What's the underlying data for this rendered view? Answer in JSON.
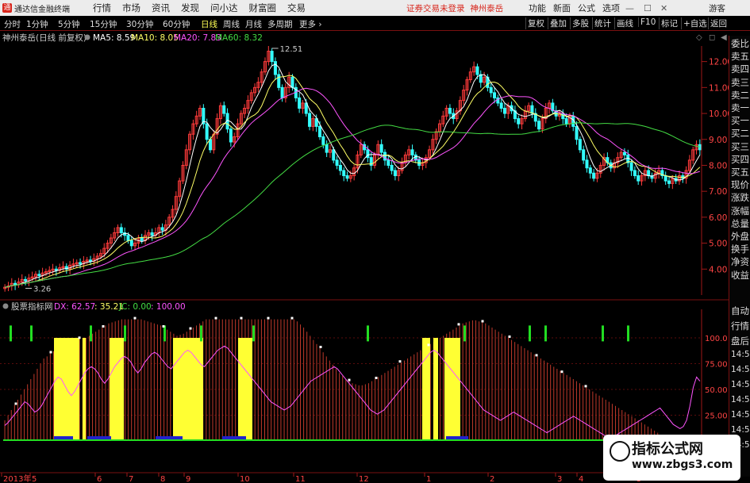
{
  "menubar": {
    "app_title": "通达信金融终端",
    "items": [
      "行情",
      "市场",
      "资讯",
      "发现",
      "问小达",
      "财富圈",
      "交易"
    ],
    "notice": "证券交易未登录",
    "stock": "神州泰岳",
    "right_items": [
      "功能",
      "新面",
      "公式",
      "选项"
    ],
    "guest": "游客"
  },
  "toolbar": {
    "timeframes": [
      "分时",
      "1分钟",
      "5分钟",
      "15分钟",
      "30分钟",
      "60分钟",
      "日线",
      "周线",
      "月线",
      "多周期",
      "更多"
    ],
    "active": "日线",
    "right_buttons": [
      "复权",
      "叠加",
      "多股",
      "统计",
      "画线",
      "F10",
      "标记",
      "+自选",
      "返回"
    ]
  },
  "right_panel": {
    "tabs": [
      "委比",
      "卖五",
      "卖四",
      "卖三",
      "卖二",
      "卖一",
      "买一",
      "买二",
      "买三",
      "买四",
      "买五",
      "现价",
      "涨跌",
      "涨幅",
      "总量",
      "外盘",
      "换手",
      "净资",
      "收益"
    ],
    "tabs2": [
      "自动",
      "行情",
      "盘后",
      "14:50",
      "14:50",
      "14:50",
      "14:50",
      "14:50",
      "14:50",
      "14:50"
    ]
  },
  "colors": {
    "up": "#ff3b3b",
    "down": "#33ffff",
    "ma5": "#ffffff",
    "ma10": "#ffff66",
    "ma20": "#ff55ff",
    "ma60": "#44dd44",
    "bar_red": "#c0392b",
    "bar_yellow": "#ffff33",
    "bar_blue": "#2222cc",
    "green_signal": "#22dd22",
    "dx_line": "#ff55ff"
  },
  "watermark": {
    "line1": "指标公式网",
    "line2": "www.zbgs3.com"
  },
  "chart_data": [
    {
      "type": "candlestick",
      "title": "神州泰岳(日线 前复权)",
      "legend": [
        {
          "name": "MA5",
          "value": "8.59",
          "color": "#ffffff"
        },
        {
          "name": "MA10",
          "value": "8.05",
          "color": "#ffff66"
        },
        {
          "name": "MA20",
          "value": "7.83",
          "color": "#ff55ff"
        },
        {
          "name": "MA60",
          "value": "8.32",
          "color": "#44dd44"
        }
      ],
      "ylim": [
        3.0,
        12.6
      ],
      "yticks": [
        "12.00",
        "11.00",
        "10.00",
        "9.00",
        "8.00",
        "7.00",
        "6.00",
        "5.00",
        "4.00"
      ],
      "ytick_values": [
        12,
        11,
        10,
        9,
        8,
        7,
        6,
        5,
        4
      ],
      "annotations": [
        {
          "text": "12.51",
          "x": 78,
          "y": 12.51
        },
        {
          "text": "3.26",
          "x": 6,
          "y": 3.26
        }
      ],
      "close": [
        3.3,
        3.35,
        3.45,
        3.4,
        3.5,
        3.6,
        3.55,
        3.65,
        3.7,
        3.8,
        3.75,
        3.85,
        3.9,
        3.95,
        4.0,
        3.95,
        4.05,
        4.1,
        4.0,
        4.15,
        4.2,
        4.25,
        4.2,
        4.3,
        4.35,
        4.3,
        4.4,
        4.5,
        4.6,
        4.8,
        5.0,
        5.2,
        5.4,
        5.6,
        5.4,
        5.3,
        5.1,
        4.9,
        5.0,
        5.2,
        5.1,
        5.3,
        5.4,
        5.3,
        5.4,
        5.6,
        5.5,
        5.7,
        6.0,
        6.3,
        6.8,
        7.4,
        8.0,
        8.6,
        9.2,
        9.6,
        9.9,
        10.2,
        9.6,
        9.0,
        8.6,
        9.2,
        9.8,
        10.3,
        10.0,
        9.4,
        8.9,
        9.1,
        9.6,
        10.0,
        10.2,
        10.5,
        10.8,
        11.0,
        11.2,
        11.6,
        12.0,
        12.4,
        12.0,
        11.5,
        11.0,
        10.6,
        11.0,
        11.4,
        11.0,
        10.6,
        10.2,
        10.4,
        10.0,
        9.5,
        9.8,
        9.5,
        9.1,
        8.8,
        8.5,
        8.6,
        8.2,
        8.0,
        7.8,
        7.6,
        7.5,
        7.6,
        7.9,
        8.4,
        8.8,
        8.6,
        8.3,
        8.0,
        8.4,
        8.8,
        8.5,
        8.2,
        8.0,
        7.8,
        7.6,
        7.8,
        8.1,
        8.4,
        8.6,
        8.4,
        8.2,
        8.0,
        8.1,
        8.3,
        8.6,
        9.0,
        9.3,
        9.6,
        9.9,
        10.2,
        10.0,
        9.8,
        10.1,
        10.5,
        10.9,
        11.3,
        11.6,
        11.8,
        11.5,
        11.2,
        11.4,
        11.0,
        10.8,
        10.6,
        10.4,
        10.2,
        10.0,
        10.3,
        10.1,
        9.8,
        9.6,
        9.8,
        10.1,
        10.3,
        10.0,
        9.7,
        9.4,
        9.8,
        10.2,
        10.4,
        10.1,
        9.9,
        10.0,
        9.8,
        9.6,
        9.9,
        9.5,
        9.0,
        8.6,
        8.2,
        7.9,
        7.7,
        7.5,
        7.7,
        8.0,
        8.3,
        8.1,
        7.9,
        8.1,
        8.3,
        8.5,
        8.4,
        8.1,
        7.8,
        7.6,
        7.4,
        7.6,
        7.8,
        7.6,
        7.5,
        7.7,
        7.8,
        7.6,
        7.4,
        7.3,
        7.5,
        7.4,
        7.6,
        7.5,
        7.8,
        8.2,
        8.6,
        8.8,
        8.6
      ],
      "series_names": [
        "MA5",
        "MA10",
        "MA20",
        "MA60"
      ],
      "xlabels": [
        "2013年",
        "5",
        "6",
        "7",
        "8",
        "9",
        "10",
        "11",
        "12",
        "1",
        "2",
        "3",
        "4",
        "5"
      ]
    },
    {
      "type": "indicator",
      "title": "股票指标网",
      "legend": [
        {
          "name": "DX",
          "value": "62.57",
          "color": "#ff55ff"
        },
        {
          "name": "",
          "value": "35.21",
          "color": "#ffff66"
        },
        {
          "name": "JC",
          "value": "0.00",
          "color": "#44dd44"
        },
        {
          "name": "",
          "value": "100.00",
          "color": "#ff55ff"
        }
      ],
      "ylim": [
        0,
        120
      ],
      "yticks": [
        "100.0",
        "75.00",
        "50.00",
        "25.00"
      ],
      "ytick_values": [
        100,
        75,
        50,
        25
      ],
      "bars": [
        20,
        25,
        30,
        35,
        40,
        45,
        50,
        55,
        60,
        65,
        70,
        75,
        80,
        82,
        85,
        87,
        90,
        92,
        94,
        95,
        96,
        97,
        98,
        99,
        100,
        100,
        102,
        104,
        106,
        108,
        110,
        112,
        114,
        115,
        116,
        117,
        118,
        118,
        119,
        119,
        120,
        119,
        118,
        117,
        116,
        115,
        114,
        113,
        112,
        110,
        108,
        106,
        104,
        102,
        103,
        104,
        106,
        108,
        110,
        112,
        114,
        116,
        118,
        120,
        121,
        122,
        123,
        124,
        125,
        126,
        127,
        128,
        129,
        130,
        131,
        132,
        132,
        131,
        130,
        129,
        128,
        127,
        126,
        125,
        124,
        123,
        122,
        121,
        120,
        118,
        116,
        113,
        110,
        106,
        102,
        98,
        94,
        90,
        86,
        82,
        78,
        74,
        70,
        66,
        63,
        60,
        58,
        56,
        55,
        54,
        54,
        55,
        56,
        58,
        60,
        62,
        64,
        66,
        68,
        70,
        72,
        74,
        76,
        78,
        80,
        82,
        84,
        86,
        88,
        90,
        92,
        94,
        96,
        98,
        100,
        102,
        104,
        106,
        108,
        110,
        112,
        114,
        115,
        116,
        117,
        117,
        116,
        115,
        114,
        112,
        110,
        108,
        106,
        104,
        102,
        100,
        98,
        96,
        94,
        92,
        90,
        88,
        86,
        84,
        82,
        80,
        78,
        76,
        74,
        72,
        70,
        68,
        66,
        64,
        62,
        60,
        58,
        56,
        54,
        52,
        50,
        48,
        46,
        44,
        42,
        40,
        38,
        36,
        34,
        32,
        30,
        28,
        26,
        24,
        22,
        20,
        18,
        16,
        14,
        12,
        10,
        8,
        6,
        4,
        4,
        4,
        4,
        4,
        4,
        4,
        4,
        4,
        4,
        4,
        4
      ],
      "dx": [
        15,
        18,
        22,
        26,
        30,
        34,
        38,
        36,
        32,
        28,
        30,
        34,
        40,
        46,
        52,
        58,
        62,
        60,
        54,
        48,
        44,
        48,
        54,
        60,
        66,
        70,
        72,
        70,
        66,
        60,
        56,
        60,
        66,
        72,
        76,
        80,
        82,
        80,
        76,
        70,
        66,
        70,
        76,
        80,
        84,
        86,
        84,
        80,
        76,
        72,
        70,
        74,
        78,
        82,
        86,
        88,
        86,
        82,
        78,
        74,
        72,
        76,
        80,
        84,
        88,
        90,
        92,
        90,
        86,
        82,
        78,
        74,
        70,
        66,
        62,
        58,
        54,
        50,
        46,
        42,
        38,
        36,
        34,
        32,
        30,
        32,
        34,
        38,
        42,
        46,
        50,
        54,
        58,
        60,
        62,
        64,
        66,
        68,
        70,
        72,
        70,
        66,
        62,
        58,
        54,
        50,
        46,
        42,
        38,
        34,
        30,
        28,
        26,
        28,
        30,
        34,
        38,
        42,
        46,
        50,
        54,
        58,
        62,
        66,
        70,
        74,
        78,
        82,
        86,
        88,
        86,
        82,
        78,
        74,
        70,
        66,
        62,
        58,
        54,
        50,
        46,
        42,
        38,
        34,
        30,
        28,
        26,
        24,
        22,
        20,
        22,
        24,
        26,
        28,
        26,
        24,
        22,
        20,
        18,
        16,
        14,
        12,
        10,
        8,
        10,
        12,
        14,
        16,
        18,
        20,
        22,
        24,
        22,
        20,
        18,
        16,
        14,
        12,
        10,
        8,
        6,
        4,
        2,
        4,
        6,
        8,
        10,
        12,
        14,
        16,
        18,
        20,
        22,
        24,
        26,
        28,
        30,
        32,
        28,
        24,
        20,
        16,
        14,
        12,
        14,
        20,
        34,
        52,
        62,
        58
      ]
    }
  ]
}
